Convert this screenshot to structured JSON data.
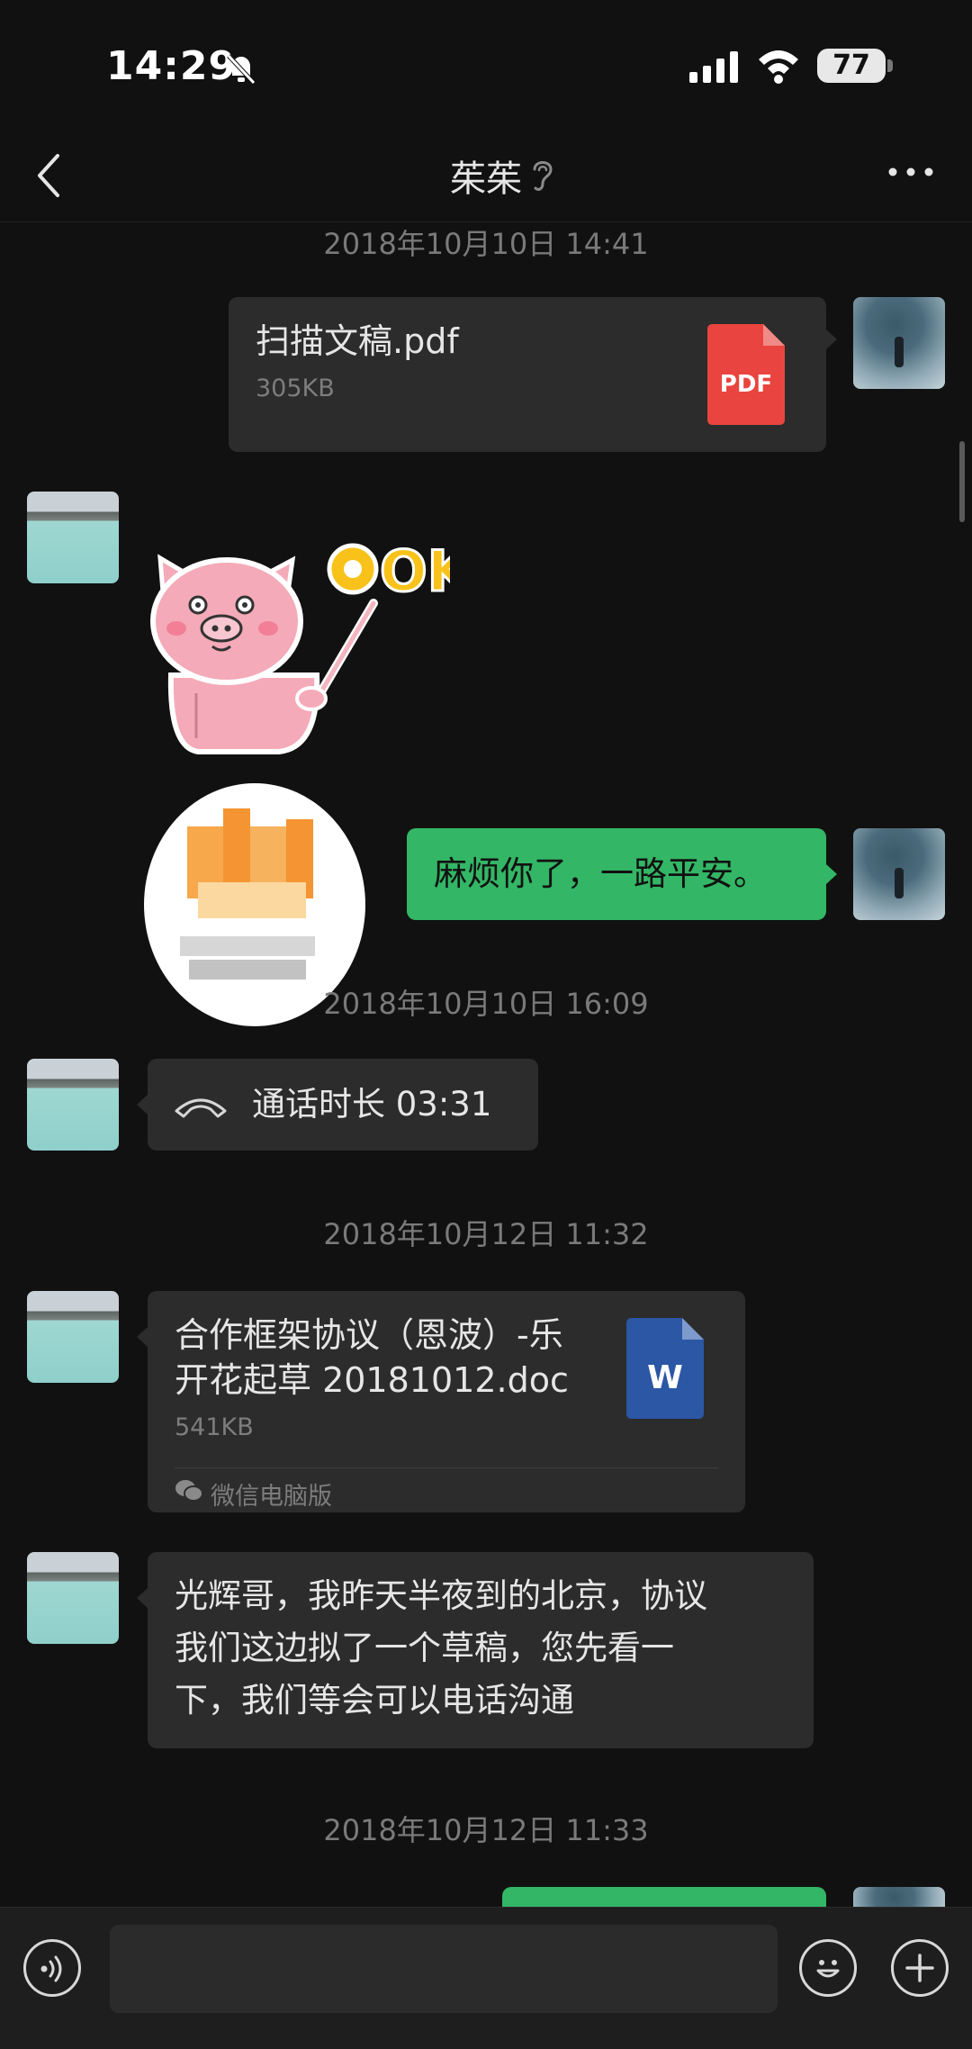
{
  "status_bar": {
    "time": "14:29",
    "battery": "77"
  },
  "header": {
    "title": "茱茱"
  },
  "messages": {
    "ts1": "2018年10月10日 14:41",
    "file1": {
      "name": "扫描文稿.pdf",
      "size": "305KB",
      "badge": "PDF"
    },
    "sticker_text": "OK",
    "text1": "麻烦你了，一路平安。",
    "ts2": "2018年10月10日 16:09",
    "call": "通话时长 03:31",
    "ts3": "2018年10月12日 11:32",
    "file2": {
      "name_line1": "合作框架协议（恩波）-乐",
      "name_line2": "开花起草 20181012.doc",
      "size": "541KB",
      "badge": "W",
      "source": "微信电脑版"
    },
    "text2": {
      "line1": "光辉哥，我昨天半夜到的北京，协议",
      "line2": "我们这边拟了一个草稿，您先看一",
      "line3": "下，我们等会可以电话沟通"
    },
    "ts4": "2018年10月12日 11:33"
  },
  "icons": {
    "back": "back-chevron-icon",
    "ear": "ear-icon",
    "more": "more-dots-icon",
    "voice": "voice-icon",
    "emoji": "emoji-icon",
    "plus": "plus-icon",
    "call": "phone-icon",
    "wechat": "wechat-icon"
  },
  "colors": {
    "background": "#111111",
    "bubble_dark": "#2c2c2c",
    "bubble_green": "#33b665",
    "pdf_red": "#e9443f",
    "word_blue": "#2b57a4"
  }
}
